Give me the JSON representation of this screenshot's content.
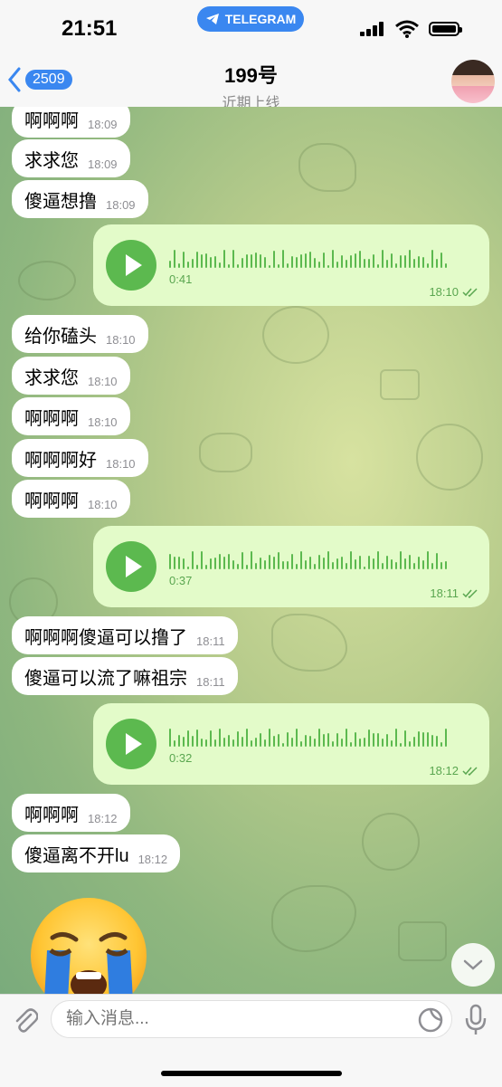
{
  "status_bar": {
    "time": "21:51",
    "app_pill": "TELEGRAM"
  },
  "header": {
    "back_count": "2509",
    "title": "199号",
    "subtitle": "近期上线"
  },
  "messages": [
    {
      "type": "text",
      "text": "啊啊啊",
      "time": "18:09"
    },
    {
      "type": "text",
      "text": "求求您",
      "time": "18:09"
    },
    {
      "type": "text",
      "text": "傻逼想撸",
      "time": "18:09"
    },
    {
      "type": "voice",
      "duration": "0:41",
      "time": "18:10"
    },
    {
      "type": "text",
      "text": "给你磕头",
      "time": "18:10"
    },
    {
      "type": "text",
      "text": "求求您",
      "time": "18:10"
    },
    {
      "type": "text",
      "text": "啊啊啊",
      "time": "18:10"
    },
    {
      "type": "text",
      "text": "啊啊啊好",
      "time": "18:10"
    },
    {
      "type": "text",
      "text": "啊啊啊",
      "time": "18:10"
    },
    {
      "type": "voice",
      "duration": "0:37",
      "time": "18:11"
    },
    {
      "type": "text",
      "text": "啊啊啊傻逼可以撸了",
      "time": "18:11"
    },
    {
      "type": "text",
      "text": "傻逼可以流了嘛祖宗",
      "time": "18:11"
    },
    {
      "type": "voice",
      "duration": "0:32",
      "time": "18:12"
    },
    {
      "type": "text",
      "text": "啊啊啊",
      "time": "18:12"
    },
    {
      "type": "text",
      "text": "傻逼离不开lu",
      "time": "18:12"
    },
    {
      "type": "emoji",
      "name": "loudly-crying-face-emoji"
    }
  ],
  "composer": {
    "placeholder": "输入消息..."
  },
  "colors": {
    "accent": "#3a87f0",
    "outgoing_bubble": "#e3fbc9",
    "play_green": "#5cb94f"
  }
}
